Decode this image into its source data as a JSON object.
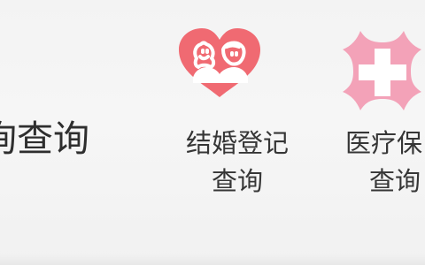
{
  "left_item": {
    "label_fragment": "询查询"
  },
  "services": [
    {
      "line1": "结婚登记",
      "line2": "查询",
      "icon": "heart-couple-icon"
    },
    {
      "line1": "医疗保",
      "line2": "查询",
      "icon": "medical-cross-icon"
    }
  ],
  "colors": {
    "heart": "#f06a72",
    "medical": "#f3a2b8",
    "text": "#363636"
  }
}
